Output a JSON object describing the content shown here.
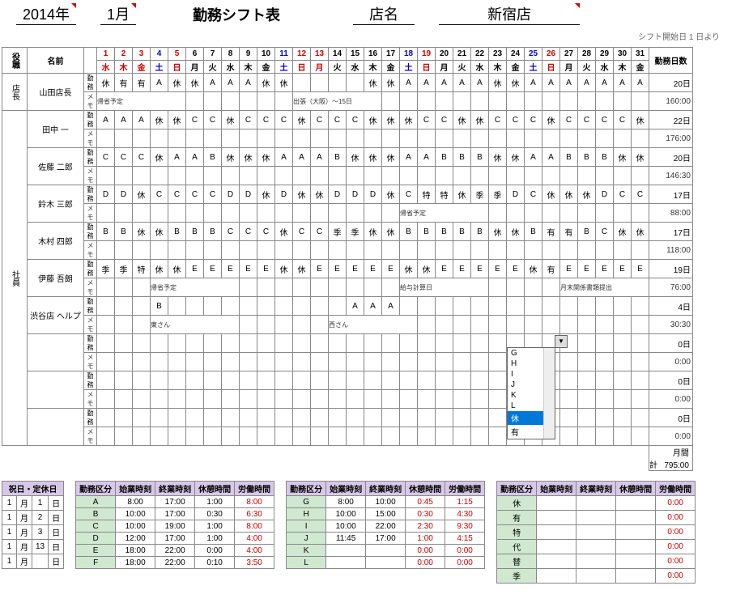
{
  "header": {
    "year": "2014",
    "year_suffix": "年",
    "month": "1",
    "month_suffix": "月",
    "title": "勤務シフト表",
    "store_label": "店名",
    "store_name": "新宿店",
    "shift_start": "シフト開始日 1 日より"
  },
  "cols": {
    "role": "役職",
    "name": "名前",
    "days_worked": "勤務日数"
  },
  "days": [
    {
      "d": "1",
      "w": "水",
      "c": "r"
    },
    {
      "d": "2",
      "w": "木",
      "c": "r"
    },
    {
      "d": "3",
      "w": "金",
      "c": "r"
    },
    {
      "d": "4",
      "w": "土",
      "c": "b"
    },
    {
      "d": "5",
      "w": "日",
      "c": "r"
    },
    {
      "d": "6",
      "w": "月",
      "c": ""
    },
    {
      "d": "7",
      "w": "火",
      "c": ""
    },
    {
      "d": "8",
      "w": "水",
      "c": ""
    },
    {
      "d": "9",
      "w": "木",
      "c": ""
    },
    {
      "d": "10",
      "w": "金",
      "c": ""
    },
    {
      "d": "11",
      "w": "土",
      "c": "b"
    },
    {
      "d": "12",
      "w": "日",
      "c": "r"
    },
    {
      "d": "13",
      "w": "月",
      "c": "r"
    },
    {
      "d": "14",
      "w": "火",
      "c": ""
    },
    {
      "d": "15",
      "w": "水",
      "c": ""
    },
    {
      "d": "16",
      "w": "木",
      "c": ""
    },
    {
      "d": "17",
      "w": "金",
      "c": ""
    },
    {
      "d": "18",
      "w": "土",
      "c": "b"
    },
    {
      "d": "19",
      "w": "日",
      "c": "r"
    },
    {
      "d": "20",
      "w": "月",
      "c": ""
    },
    {
      "d": "21",
      "w": "火",
      "c": ""
    },
    {
      "d": "22",
      "w": "水",
      "c": ""
    },
    {
      "d": "23",
      "w": "木",
      "c": ""
    },
    {
      "d": "24",
      "w": "金",
      "c": ""
    },
    {
      "d": "25",
      "w": "土",
      "c": "b"
    },
    {
      "d": "26",
      "w": "日",
      "c": "r"
    },
    {
      "d": "27",
      "w": "月",
      "c": ""
    },
    {
      "d": "28",
      "w": "火",
      "c": ""
    },
    {
      "d": "29",
      "w": "水",
      "c": ""
    },
    {
      "d": "30",
      "w": "木",
      "c": ""
    },
    {
      "d": "31",
      "w": "金",
      "c": ""
    }
  ],
  "staff": [
    {
      "role": "店長",
      "name": "山田店長",
      "sub1": "勤務",
      "sub2": "メモ",
      "shifts": [
        "休",
        "有",
        "有",
        "A",
        "休",
        "休",
        "A",
        "A",
        "A",
        "休",
        "休",
        "",
        "",
        "",
        "",
        "休",
        "休",
        "A",
        "A",
        "A",
        "A",
        "A",
        "休",
        "休",
        "A",
        "A",
        "A",
        "A",
        "A",
        "A",
        "A"
      ],
      "memo": {
        "0": "帰省予定",
        "11": "出張（大阪）～15日"
      },
      "days": "20日",
      "hours": "160:00"
    },
    {
      "role": "社員",
      "name": "田中 一",
      "sub1": "勤務",
      "sub2": "メモ",
      "shifts": [
        "A",
        "A",
        "A",
        "休",
        "休",
        "C",
        "C",
        "休",
        "C",
        "C",
        "C",
        "休",
        "C",
        "C",
        "C",
        "休",
        "休",
        "休",
        "C",
        "C",
        "休",
        "休",
        "C",
        "C",
        "C",
        "休",
        "C",
        "C",
        "C",
        "C",
        "休"
      ],
      "memo": {},
      "days": "22日",
      "hours": "176:00"
    },
    {
      "role": "",
      "name": "佐藤 二郎",
      "sub1": "勤務",
      "sub2": "メモ",
      "shifts": [
        "C",
        "C",
        "C",
        "休",
        "A",
        "A",
        "B",
        "休",
        "休",
        "休",
        "A",
        "A",
        "A",
        "B",
        "休",
        "休",
        "休",
        "A",
        "A",
        "B",
        "B",
        "B",
        "休",
        "休",
        "A",
        "A",
        "B",
        "B",
        "B",
        "休",
        "休"
      ],
      "memo": {},
      "days": "20日",
      "hours": "146:30"
    },
    {
      "role": "",
      "name": "鈴木 三郎",
      "sub1": "勤務",
      "sub2": "メモ",
      "shifts": [
        "D",
        "D",
        "休",
        "C",
        "C",
        "C",
        "C",
        "D",
        "D",
        "休",
        "D",
        "休",
        "休",
        "D",
        "D",
        "D",
        "休",
        "C",
        "特",
        "特",
        "休",
        "季",
        "季",
        "D",
        "C",
        "休",
        "休",
        "休",
        "D",
        "C",
        "C"
      ],
      "memo": {
        "17": "帰省予定"
      },
      "days": "17日",
      "hours": "88:00"
    },
    {
      "role": "",
      "name": "木村 四郎",
      "sub1": "勤務",
      "sub2": "メモ",
      "shifts": [
        "B",
        "B",
        "休",
        "休",
        "B",
        "B",
        "B",
        "C",
        "C",
        "C",
        "休",
        "C",
        "C",
        "季",
        "季",
        "休",
        "休",
        "B",
        "B",
        "B",
        "B",
        "B",
        "休",
        "休",
        "B",
        "有",
        "有",
        "B",
        "C",
        "休",
        "休"
      ],
      "memo": {},
      "days": "17日",
      "hours": "118:00"
    },
    {
      "role": "",
      "name": "伊藤 吾朗",
      "sub1": "勤務",
      "sub2": "メモ",
      "shifts": [
        "季",
        "季",
        "特",
        "休",
        "休",
        "E",
        "E",
        "E",
        "E",
        "E",
        "休",
        "休",
        "E",
        "E",
        "E",
        "E",
        "E",
        "休",
        "休",
        "E",
        "E",
        "E",
        "E",
        "E",
        "休",
        "有",
        "E",
        "E",
        "E",
        "E",
        "E"
      ],
      "memo": {
        "3": "帰省予定",
        "17": "給与計算日",
        "26": "月末関係書類提出"
      },
      "days": "19日",
      "hours": "76:00"
    },
    {
      "role": "",
      "name": "渋谷店 ヘルプ",
      "sub1": "勤務",
      "sub2": "メモ",
      "shifts": [
        "",
        "",
        "",
        "B",
        "",
        "",
        "",
        "",
        "",
        "",
        "",
        "",
        "",
        "",
        "A",
        "A",
        "A",
        "",
        "",
        "",
        "",
        "",
        "",
        "",
        "",
        "",
        "",
        "",
        "",
        "",
        ""
      ],
      "memo": {
        "3": "東さん",
        "13": "西さん"
      },
      "days": "4日",
      "hours": "30:30"
    },
    {
      "role": "",
      "name": "",
      "sub1": "勤務",
      "sub2": "メモ",
      "shifts": [],
      "memo": {},
      "days": "0日",
      "hours": "0:00"
    },
    {
      "role": "",
      "name": "",
      "sub1": "勤務",
      "sub2": "メモ",
      "shifts": [],
      "memo": {},
      "days": "0日",
      "hours": "0:00"
    },
    {
      "role": "",
      "name": "",
      "sub1": "勤務",
      "sub2": "メモ",
      "shifts": [],
      "memo": {},
      "days": "0日",
      "hours": "0:00"
    }
  ],
  "dropdown": {
    "items": [
      "G",
      "H",
      "I",
      "J",
      "K",
      "L",
      "休",
      "有"
    ],
    "selected": "休"
  },
  "footer": {
    "label": "月間計",
    "total": "795:00"
  },
  "holidays": {
    "header": "祝日・定休日",
    "rows": [
      [
        "1",
        "月",
        "1",
        "日"
      ],
      [
        "1",
        "月",
        "2",
        "日"
      ],
      [
        "1",
        "月",
        "3",
        "日"
      ],
      [
        "1",
        "月",
        "13",
        "日"
      ],
      [
        "1",
        "月",
        "",
        "日"
      ]
    ]
  },
  "shift_headers": [
    "勤務区分",
    "始業時刻",
    "終業時刻",
    "休憩時間",
    "労働時間"
  ],
  "shift_tables": [
    [
      {
        "code": "A",
        "s": "8:00",
        "e": "17:00",
        "b": "1:00",
        "w": "8:00",
        "wr": true
      },
      {
        "code": "B",
        "s": "10:00",
        "e": "17:00",
        "b": "0:30",
        "w": "6:30",
        "wr": true
      },
      {
        "code": "C",
        "s": "10:00",
        "e": "19:00",
        "b": "1:00",
        "w": "8:00",
        "wr": true
      },
      {
        "code": "D",
        "s": "12:00",
        "e": "17:00",
        "b": "1:00",
        "w": "4:00",
        "wr": true
      },
      {
        "code": "E",
        "s": "18:00",
        "e": "22:00",
        "b": "0:00",
        "w": "4:00",
        "wr": true
      },
      {
        "code": "F",
        "s": "18:00",
        "e": "22:00",
        "b": "0:10",
        "w": "3:50",
        "wr": true
      }
    ],
    [
      {
        "code": "G",
        "s": "8:00",
        "e": "10:00",
        "b": "0:45",
        "w": "1:15",
        "wr": true,
        "br": true
      },
      {
        "code": "H",
        "s": "10:00",
        "e": "15:00",
        "b": "0:30",
        "w": "4:30",
        "wr": true,
        "br": true
      },
      {
        "code": "I",
        "s": "10:00",
        "e": "22:00",
        "b": "2:30",
        "w": "9:30",
        "wr": true,
        "br": true
      },
      {
        "code": "J",
        "s": "11:45",
        "e": "17:00",
        "b": "1:00",
        "w": "4:15",
        "wr": true,
        "br": true
      },
      {
        "code": "K",
        "s": "",
        "e": "",
        "b": "0:00",
        "w": "0:00",
        "wr": true,
        "br": true
      },
      {
        "code": "L",
        "s": "",
        "e": "",
        "b": "0:00",
        "w": "0:00",
        "wr": true,
        "br": true
      }
    ],
    [
      {
        "code": "休",
        "s": "",
        "e": "",
        "b": "",
        "w": "0:00",
        "wr": true
      },
      {
        "code": "有",
        "s": "",
        "e": "",
        "b": "",
        "w": "0:00",
        "wr": true
      },
      {
        "code": "特",
        "s": "",
        "e": "",
        "b": "",
        "w": "0:00",
        "wr": true
      },
      {
        "code": "代",
        "s": "",
        "e": "",
        "b": "",
        "w": "0:00",
        "wr": true
      },
      {
        "code": "替",
        "s": "",
        "e": "",
        "b": "",
        "w": "0:00",
        "wr": true
      },
      {
        "code": "季",
        "s": "",
        "e": "",
        "b": "",
        "w": "0:00",
        "wr": true
      }
    ]
  ]
}
